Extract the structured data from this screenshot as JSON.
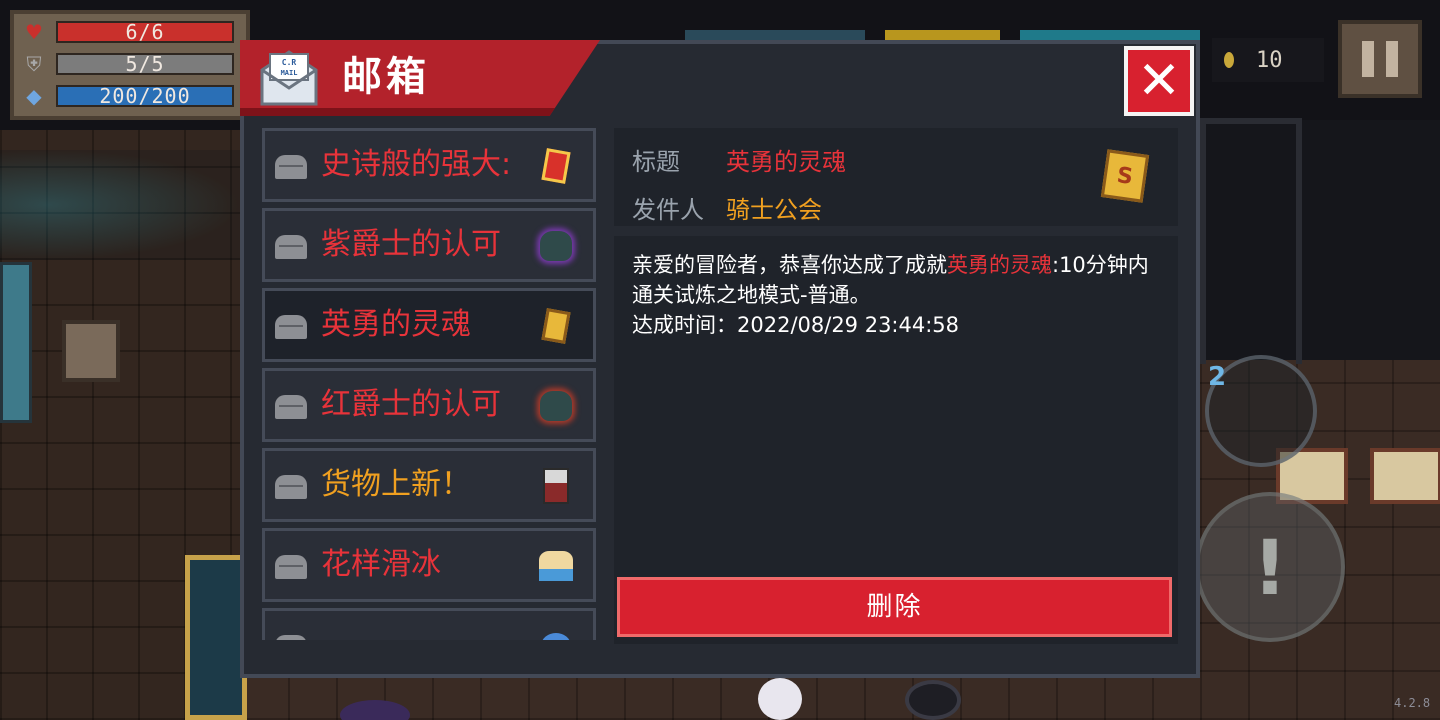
{
  "hud": {
    "health": "6/6",
    "armor": "5/5",
    "energy": "200/200",
    "health_fraction": 1.0,
    "armor_fraction": 1.0,
    "energy_fraction": 1.0,
    "coins": "10",
    "skill_charges": "2",
    "version": "4.2.8",
    "icons": {
      "health": "heart-icon",
      "armor": "shield-icon",
      "energy": "diamond-icon",
      "coin": "coin-icon",
      "pause": "pause-icon",
      "attack": "attack-icon"
    },
    "colors": {
      "health": "#c9302c",
      "armor": "#7c7c7c",
      "energy": "#2a6fb6"
    }
  },
  "mailbox": {
    "title": "邮箱",
    "mail_icon_label": "C.R MAIL",
    "close_label": "✕",
    "items": [
      {
        "label": "史诗般的强大:",
        "color": "#e8333a",
        "icon": "red-card-icon"
      },
      {
        "label": "紫爵士的认可",
        "color": "#e8333a",
        "icon": "purple-knight-helmet-icon"
      },
      {
        "label": "英勇的灵魂",
        "color": "#e8333a",
        "icon": "gold-card-icon"
      },
      {
        "label": "红爵士的认可",
        "color": "#e8333a",
        "icon": "red-knight-helmet-icon"
      },
      {
        "label": "货物上新！",
        "color": "#f0a020",
        "icon": "merchant-icon"
      },
      {
        "label": "花样滑冰",
        "color": "#e8333a",
        "icon": "skater-icon"
      }
    ],
    "selected_index": 2,
    "detail": {
      "title_label": "标题",
      "title_value": "英勇的灵魂",
      "sender_label": "发件人",
      "sender_value": "骑士公会",
      "body_prefix": "亲爱的冒险者，恭喜你达成了成就",
      "body_highlight": "英勇的灵魂",
      "body_suffix": ":10分钟内通关试炼之地模式-普通。",
      "body_time": "达成时间：2022/08/29 23:44:58",
      "icon": "gold-card-icon"
    },
    "delete_label": "删除",
    "colors": {
      "accent_red": "#d8212f",
      "title_red": "#e8333a",
      "orange": "#f0a020"
    }
  }
}
